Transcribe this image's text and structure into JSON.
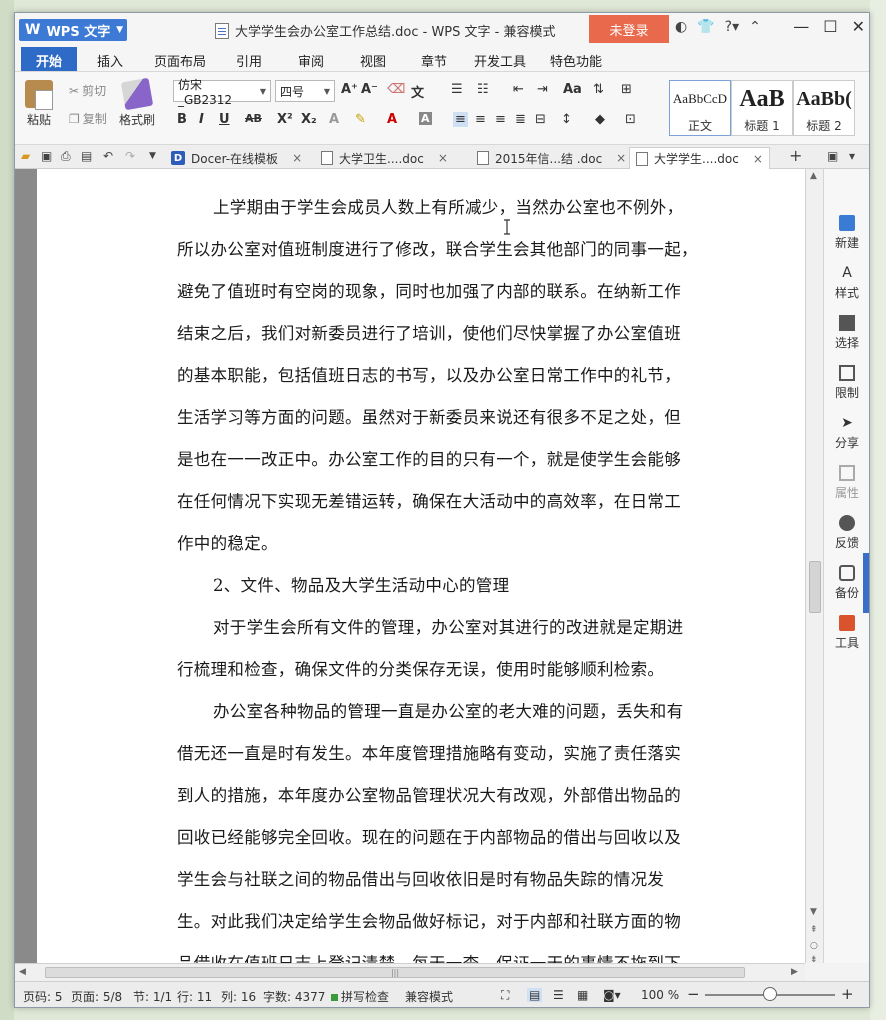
{
  "window": {
    "app_name": "WPS 文字",
    "doc_title": "大学学生会办公室工作总结.doc - WPS 文字 - 兼容模式",
    "login_label": "未登录"
  },
  "menu": {
    "tabs": [
      "开始",
      "插入",
      "页面布局",
      "引用",
      "审阅",
      "视图",
      "章节",
      "开发工具",
      "特色功能"
    ],
    "active_index": 0
  },
  "ribbon": {
    "paste": "粘贴",
    "cut": "剪切",
    "copy": "复制",
    "format_painter": "格式刷",
    "font_name": "仿宋_GB2312",
    "font_size": "四号",
    "styles": [
      {
        "sample": "AaBbCcD",
        "name": "正文"
      },
      {
        "sample": "AaB",
        "name": "标题 1"
      },
      {
        "sample": "AaBb(",
        "name": "标题 2"
      }
    ]
  },
  "doc_tabs": [
    {
      "label": "Docer-在线模板",
      "active": false
    },
    {
      "label": "大学卫生....doc",
      "active": false
    },
    {
      "label": "2015年信...结 .doc",
      "active": false
    },
    {
      "label": "大学学生....doc",
      "active": true
    }
  ],
  "document": {
    "lines": [
      "上学期由于学生会成员人数上有所减少，当然办公室也不例外，",
      "所以办公室对值班制度进行了修改，联合学生会其他部门的同事一起，",
      "避免了值班时有空岗的现象，同时也加强了内部的联系。在纳新工作",
      "结束之后，我们对新委员进行了培训，使他们尽快掌握了办公室值班",
      "的基本职能，包括值班日志的书写，以及办公室日常工作中的礼节，",
      "生活学习等方面的问题。虽然对于新委员来说还有很多不足之处，但",
      "是也在一一改正中。办公室工作的目的只有一个，就是使学生会能够",
      "在任何情况下实现无差错运转，确保在大活动中的高效率，在日常工",
      "作中的稳定。",
      "2、文件、物品及大学生活动中心的管理",
      "对于学生会所有文件的管理，办公室对其进行的改进就是定期进",
      "行梳理和检查，确保文件的分类保存无误，使用时能够顺利检索。",
      "办公室各种物品的管理一直是办公室的老大难的问题，丢失和有",
      "借无还一直是时有发生。本年度管理措施略有变动，实施了责任落实",
      "到人的措施，本年度办公室物品管理状况大有改观，外部借出物品的",
      "回收已经能够完全回收。现在的问题在于内部物品的借出与回收以及",
      "学生会与社联之间的物品借出与回收依旧是时有物品失踪的情况发",
      "生。对此我们决定给学生会物品做好标记，对于内部和社联方面的物",
      "品借收在值班日志上登记清楚，每天一查，保证一天的事情不拖到下"
    ],
    "indented_lines": [
      0,
      9,
      10,
      12
    ]
  },
  "sidebar": {
    "items": [
      "新建",
      "样式",
      "选择",
      "限制",
      "分享",
      "属性",
      "反馈",
      "备份",
      "工具"
    ]
  },
  "status": {
    "page_code": "页码: 5",
    "page": "页面: 5/8",
    "section": "节: 1/1",
    "row": "行: 11",
    "col": "列: 16",
    "word_count": "字数: 4377",
    "spell": "拼写检查",
    "compat": "兼容模式",
    "zoom": "100 %"
  }
}
